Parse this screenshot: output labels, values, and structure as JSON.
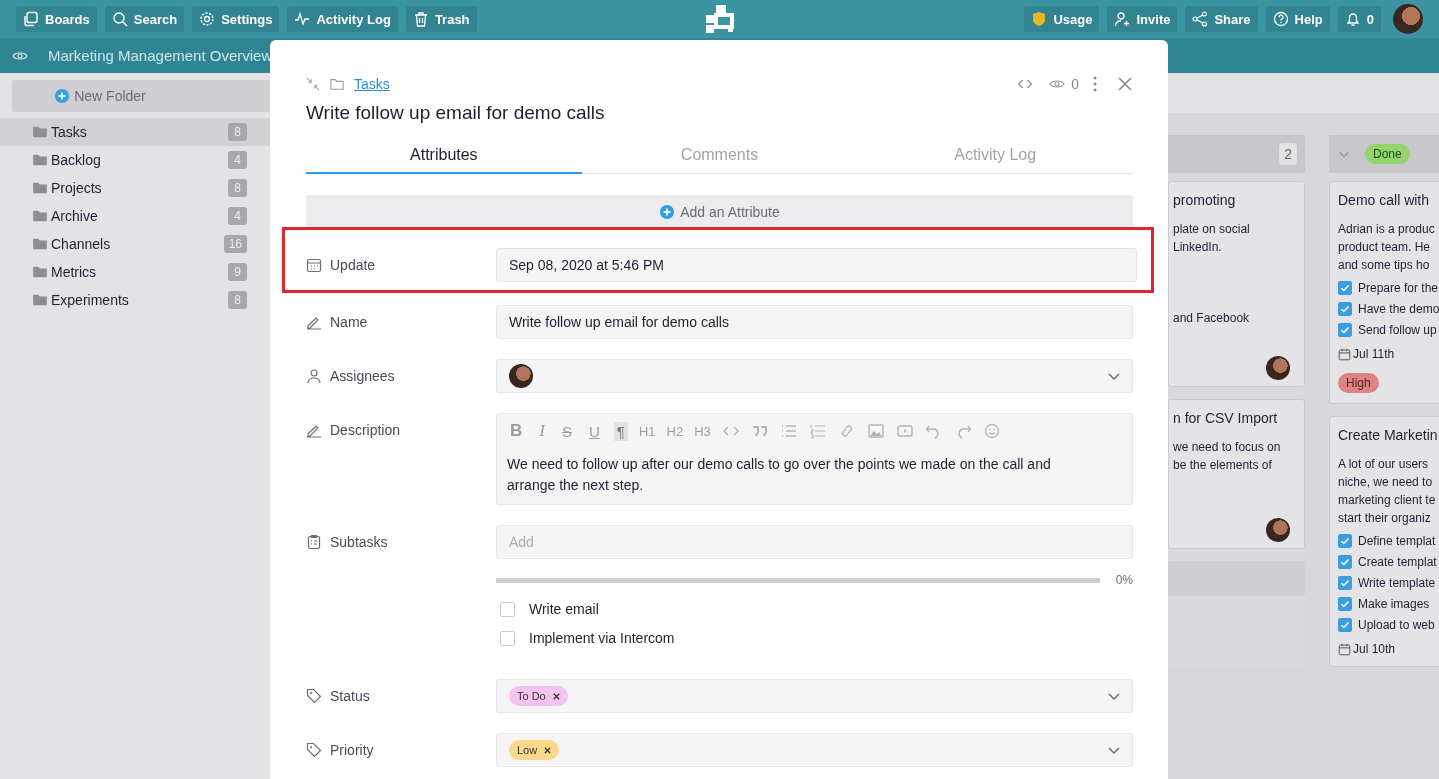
{
  "topbar": {
    "left_buttons": [
      "Boards",
      "Search",
      "Settings",
      "Activity Log",
      "Trash"
    ],
    "right_buttons": [
      "Usage",
      "Invite",
      "Share",
      "Help",
      "0"
    ]
  },
  "board_title": "Marketing Management Overview",
  "sidebar": {
    "new_folder": "New Folder",
    "folders": [
      {
        "name": "Tasks",
        "count": "8",
        "selected": true
      },
      {
        "name": "Backlog",
        "count": "4",
        "selected": false
      },
      {
        "name": "Projects",
        "count": "8",
        "selected": false
      },
      {
        "name": "Archive",
        "count": "4",
        "selected": false
      },
      {
        "name": "Channels",
        "count": "16",
        "selected": false
      },
      {
        "name": "Metrics",
        "count": "9",
        "selected": false
      },
      {
        "name": "Experiments",
        "count": "8",
        "selected": false
      }
    ]
  },
  "board": {
    "columns": [
      {
        "count": "2",
        "cards": [
          {
            "title": "promoting",
            "lines": [
              "plate on social",
              "LinkedIn.",
              "and Facebook"
            ],
            "assignee": true
          },
          {
            "title": "n for CSV Import",
            "lines": [
              "we need to focus on",
              "be the elements of"
            ],
            "assignee": true
          }
        ]
      },
      {
        "badge": {
          "text": "Done",
          "color": "#93d46c"
        },
        "cards": [
          {
            "title": "Demo call with",
            "lines": [
              "Adrian is a produc",
              "product team. He",
              "and some tips ho"
            ],
            "checks": [
              {
                "text": "Prepare for the",
                "checked": true
              },
              {
                "text": "Have the demo",
                "checked": true
              },
              {
                "text": "Send follow up",
                "checked": true
              }
            ],
            "date": "Jul 11th",
            "tag": {
              "text": "High",
              "color": "#df8484"
            }
          },
          {
            "title": "Create Marketin",
            "lines": [
              "A lot of our users",
              "niche, we need to",
              "marketing client te",
              "start their organiz"
            ],
            "checks": [
              {
                "text": "Define templat",
                "checked": true
              },
              {
                "text": "Create templat",
                "checked": true
              },
              {
                "text": "Write template",
                "checked": true
              },
              {
                "text": "Make images",
                "checked": true
              },
              {
                "text": "Upload to web",
                "checked": true
              }
            ],
            "date": "Jul 10th"
          }
        ]
      }
    ]
  },
  "modal": {
    "breadcrumb": "Tasks",
    "watchers": "0",
    "title": "Write follow up email for demo calls",
    "tabs": [
      {
        "label": "Attributes",
        "selected": true
      },
      {
        "label": "Comments",
        "selected": false
      },
      {
        "label": "Activity Log",
        "selected": false
      }
    ],
    "add_attribute": "Add an Attribute",
    "attributes": [
      {
        "kind": "date",
        "label": "Update",
        "value": "Sep 08, 2020 at 5:46 PM",
        "highlighted": true
      },
      {
        "kind": "text",
        "label": "Name",
        "value": "Write follow up email for demo calls"
      },
      {
        "kind": "people",
        "label": "Assignees"
      },
      {
        "kind": "richtext",
        "label": "Description",
        "toolbar": [
          {
            "label": "B",
            "selected": false
          },
          {
            "label": "I",
            "selected": false
          },
          {
            "label": "S",
            "selected": false
          },
          {
            "label": "U",
            "selected": false
          },
          {
            "label": "¶",
            "selected": true
          },
          {
            "label": "H1",
            "selected": false
          },
          {
            "label": "H2",
            "selected": false
          },
          {
            "label": "H3",
            "selected": false
          }
        ],
        "value": "We need to follow up after our demo calls to go over the points we made on the call and arrange the next step."
      },
      {
        "kind": "subtasks",
        "label": "Subtasks",
        "placeholder": "Add",
        "level": 0,
        "percent": "0%",
        "items": [
          {
            "text": "Write email",
            "checked": false
          },
          {
            "text": "Implement via Intercom",
            "checked": false
          }
        ]
      },
      {
        "kind": "tags",
        "label": "Status",
        "tags": [
          {
            "text": "To Do",
            "color": "#f4c4ef"
          }
        ]
      },
      {
        "kind": "tags",
        "label": "Priority",
        "tags": [
          {
            "text": "Low",
            "color": "#fbd98a"
          }
        ]
      }
    ]
  }
}
